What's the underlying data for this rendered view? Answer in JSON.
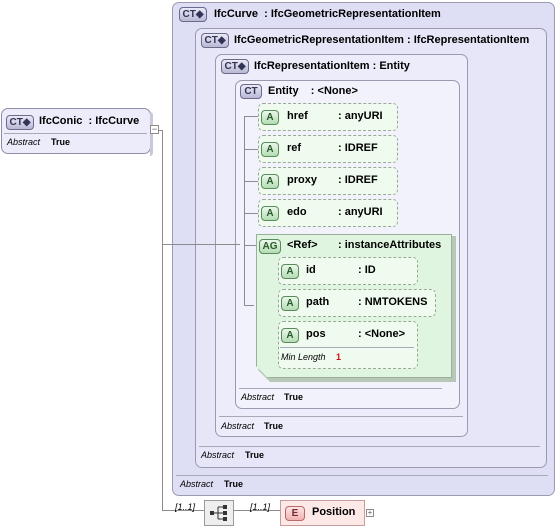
{
  "ifc_conic": {
    "badge": "CT",
    "name": "IfcConic",
    "base": ": IfcCurve",
    "abstract_key": "Abstract",
    "abstract_val": "True"
  },
  "ifc_curve": {
    "badge": "CT",
    "name": "IfcCurve",
    "base": ": IfcGeometricRepresentationItem",
    "abstract_key": "Abstract",
    "abstract_val": "True"
  },
  "ifc_geom_item": {
    "badge": "CT",
    "name": "IfcGeometricRepresentationItem",
    "base": ": IfcRepresentationItem",
    "abstract_key": "Abstract",
    "abstract_val": "True"
  },
  "ifc_repr_item": {
    "badge": "CT",
    "name": "IfcRepresentationItem",
    "base": ": Entity",
    "abstract_key": "Abstract",
    "abstract_val": "True"
  },
  "entity": {
    "badge": "CT",
    "name": "Entity",
    "base": ": <None>",
    "abstract_key": "Abstract",
    "abstract_val": "True"
  },
  "attributes": [
    {
      "badge": "A",
      "name": "href",
      "type": ": anyURI"
    },
    {
      "badge": "A",
      "name": "ref",
      "type": ": IDREF"
    },
    {
      "badge": "A",
      "name": "proxy",
      "type": ": IDREF"
    },
    {
      "badge": "A",
      "name": "edo",
      "type": ": anyURI"
    }
  ],
  "ref_group": {
    "badge": "AG",
    "name": "<Ref>",
    "type": ": instanceAttributes",
    "attributes": [
      {
        "badge": "A",
        "name": "id",
        "type": ": ID"
      },
      {
        "badge": "A",
        "name": "path",
        "type": ": NMTOKENS"
      },
      {
        "badge": "A",
        "name": "pos",
        "type": ": <None>",
        "meta_key": "Min Length",
        "meta_val": "1"
      }
    ]
  },
  "sequence": {
    "card_left": "[1..1]",
    "card_right": "[1..1]"
  },
  "position_element": {
    "badge": "E",
    "name": "Position",
    "expand": "+"
  },
  "collapse_symbol": "−",
  "colors": {
    "complex_type_bg": "#dedef5",
    "attribute_bg": "#f0fbf0",
    "element_bg": "#fde8e8",
    "min_length_value": "#d01010"
  }
}
